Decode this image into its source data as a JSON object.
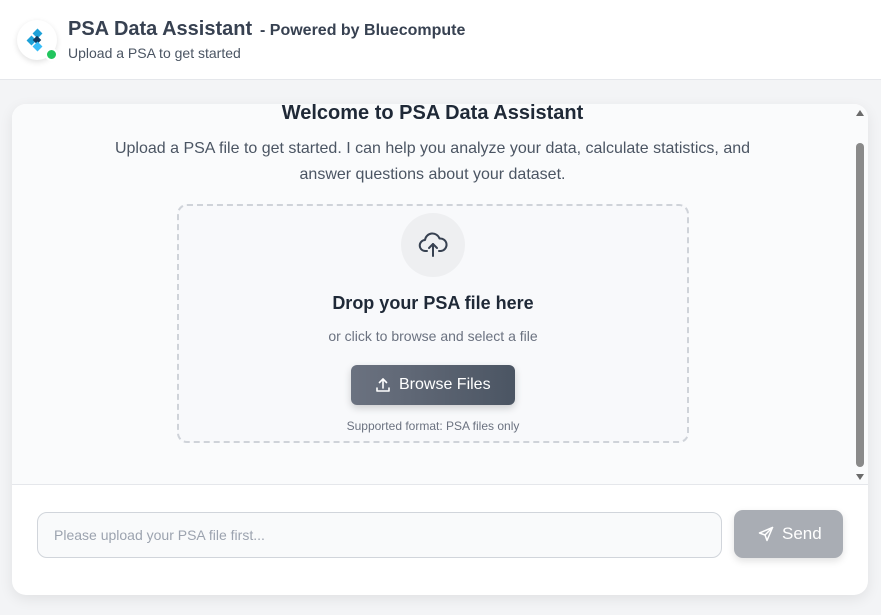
{
  "header": {
    "title": "PSA Data Assistant",
    "powered_by": "- Powered by Bluecompute",
    "subtitle": "Upload a PSA to get started",
    "logo_icon": "bluecompute-logo-icon",
    "status": "online",
    "status_color": "#22c55e"
  },
  "welcome": {
    "title": "Welcome to PSA Data Assistant",
    "text": "Upload a PSA file to get started. I can help you analyze your data, calculate statistics, and answer questions about your dataset."
  },
  "dropzone": {
    "icon": "cloud-upload-icon",
    "title": "Drop your PSA file here",
    "subtitle": "or click to browse and select a file",
    "browse_label": "Browse Files",
    "browse_icon": "upload-icon",
    "note": "Supported format: PSA files only"
  },
  "composer": {
    "placeholder": "Please upload your PSA file first...",
    "value": "",
    "send_label": "Send",
    "send_icon": "send-icon",
    "send_disabled": true
  },
  "colors": {
    "accent": "#4b5563",
    "logo_primary": "#1da1d8",
    "logo_secondary": "#0e3a5f",
    "send_disabled": "#a9adb4"
  }
}
